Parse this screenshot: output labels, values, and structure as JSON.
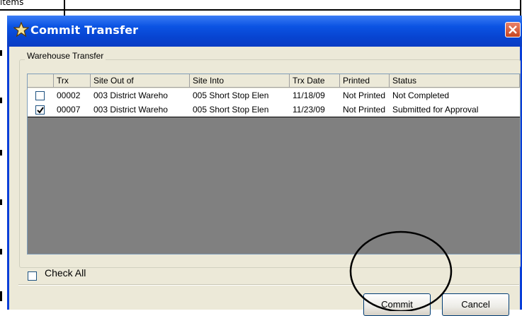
{
  "background": {
    "text": "ltems"
  },
  "window": {
    "title": "Commit Transfer",
    "close_icon": "close-x-icon",
    "title_icon": "star-icon"
  },
  "group": {
    "label": "Warehouse Transfer"
  },
  "grid": {
    "columns": [
      "",
      "Trx",
      "Site Out of",
      "Site Into",
      "Trx Date",
      "Printed",
      "Status"
    ],
    "rows": [
      {
        "checked": false,
        "trx": "00002",
        "site_out": "003 District Wareho",
        "site_into": "005 Short Stop Elen",
        "trx_date": "11/18/09",
        "printed": "Not Printed",
        "status": "Not Completed"
      },
      {
        "checked": true,
        "trx": "00007",
        "site_out": "003 District Wareho",
        "site_into": "005 Short Stop Elen",
        "trx_date": "11/23/09",
        "printed": "Not Printed",
        "status": "Submitted for Approval"
      }
    ]
  },
  "check_all": {
    "label": "Check All",
    "checked": false
  },
  "buttons": {
    "commit": "Commit",
    "cancel": "Cancel"
  },
  "colors": {
    "titlebar": "#0b53e3",
    "dialog_bg": "#ece9d8",
    "grid_bg": "#808080",
    "annotation": "#000000"
  }
}
